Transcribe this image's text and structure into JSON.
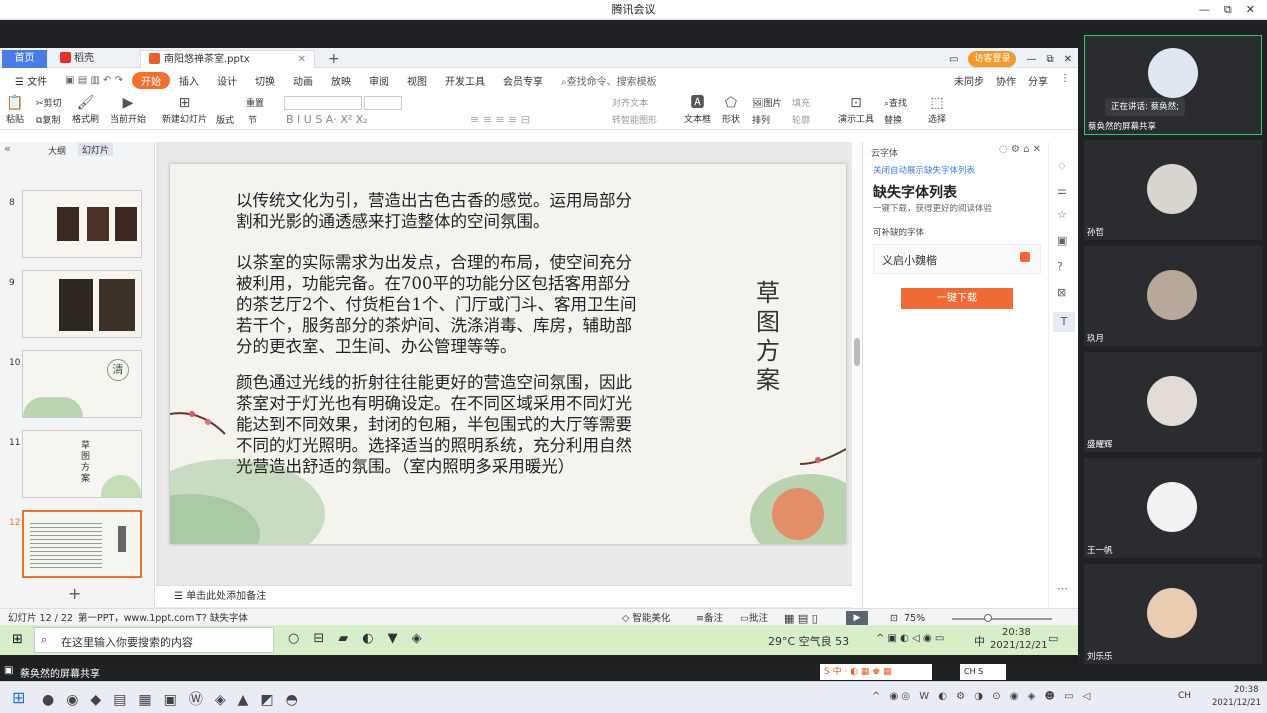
{
  "app": {
    "title": "腾讯会议",
    "win_controls": [
      "—",
      "⧉",
      "✕"
    ]
  },
  "wps": {
    "tabs": {
      "home": "首页",
      "daoke": "稻壳",
      "doc": "南阳悠禅茶室.pptx",
      "login": "访客登录"
    },
    "menu": {
      "file": "文件",
      "start": "开始",
      "items": [
        "插入",
        "设计",
        "切换",
        "动画",
        "放映",
        "审阅",
        "视图",
        "开发工具",
        "会员专享"
      ],
      "search": "查找命令、搜索模板",
      "sync": "未同步",
      "collab": "协作",
      "share": "分享"
    },
    "ribbon": {
      "paste": "粘贴",
      "cut": "剪切",
      "copy": "复制",
      "format_painter": "格式刷",
      "play": "当前开始",
      "new_slide": "新建幻灯片",
      "layout": "版式",
      "section": "节",
      "reset": "重置",
      "text_box": "文本框",
      "shape": "形状",
      "arrange": "排列",
      "picture": "图片",
      "fill": "填充",
      "outline": "轮廓",
      "present_tools": "演示工具",
      "find": "查找",
      "replace": "替换",
      "select": "选择",
      "align_text": "对齐文本",
      "smart_graphic": "转智能图形"
    },
    "panel_tabs": {
      "outline": "大纲",
      "slides": "幻灯片"
    },
    "slide_numbers": [
      "8",
      "9",
      "10",
      "11",
      "12"
    ],
    "thumb_texts": {
      "s10_char": "清",
      "s11_title": "草图方案"
    },
    "slide": {
      "p1": "以传统文化为引，营造出古色古香的感觉。运用局部分割和光影的通透感来打造整体的空间氛围。",
      "p2": "以茶室的实际需求为出发点，合理的布局，使空间充分被利用，功能完备。在700平的功能分区包括客用部分的茶艺厅2个、付货柜台1个、门厅或门斗、客用卫生间若干个，服务部分的茶炉间、洗涤消毒、库房，辅助部分的更衣室、卫生间、办公管理等等。",
      "p3": "颜色通过光线的折射往往能更好的营造空间氛围，因此茶室对于灯光也有明确设定。在不同区域采用不同灯光能达到不同效果，封闭的包厢，半包围式的大厅等需要不同的灯光照明。选择适当的照明系统，充分利用自然光营造出舒适的氛围。（室内照明多采用暖光）",
      "vertical_title": "草图方案"
    },
    "note_placeholder": "单击此处添加备注",
    "font_pane": {
      "header": "云字体",
      "close_auto": "关闭自动展示缺失字体列表",
      "title": "缺失字体列表",
      "subtitle": "一键下载，获得更好的阅读体验",
      "section": "可补缺的字体",
      "font_name": "义启小魏楷",
      "download": "一键下载"
    },
    "status": {
      "slide_info": "幻灯片 12 / 22",
      "theme": "第一PPT，www.1ppt.com",
      "missing_font": "缺失字体",
      "beautify": "智能美化",
      "notes": "备注",
      "comment": "批注",
      "zoom": "75%"
    }
  },
  "inner_taskbar": {
    "search": "在这里输入你要搜索的内容",
    "weather": "29°C 空气良 53",
    "time": "20:38",
    "date": "2021/12/21",
    "ime": "中"
  },
  "share_label": "蔡奂然的屏幕共享",
  "host_taskbar": {
    "time": "20:38",
    "date": "2021/12/21",
    "ime": "CH"
  },
  "participants": [
    {
      "name": "蔡奂然的屏幕共享",
      "speaking": "正在讲话: 蔡奂然;"
    },
    {
      "name": "孙哲"
    },
    {
      "name": "玖月"
    },
    {
      "name": "盛耀辉"
    },
    {
      "name": "王一帆"
    },
    {
      "name": "刘乐乐"
    }
  ],
  "colors": {
    "accent_orange": "#f0702e",
    "download_btn": "#f06a35",
    "link_blue": "#3a7be0",
    "meeting_bg": "#202124",
    "inner_taskbar": "#d7efc9"
  }
}
